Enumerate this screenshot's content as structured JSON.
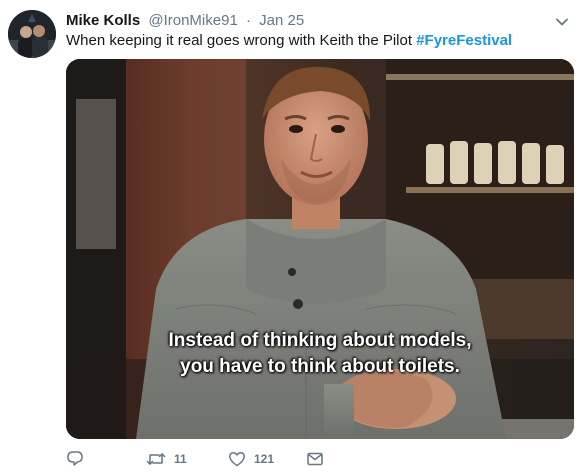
{
  "tweet": {
    "author_name": "Mike Kolls",
    "handle": "@IronMike91",
    "separator": "·",
    "date": "Jan 25",
    "text": "When keeping it real goes wrong with Keith the Pilot",
    "hashtag": "#FyreFestival",
    "media": {
      "caption_line1": "Instead of thinking about models,",
      "caption_line2": "you have to think about toilets."
    },
    "actions": {
      "reply": {
        "icon": "reply-icon"
      },
      "retweet": {
        "icon": "retweet-icon",
        "count": "11"
      },
      "like": {
        "icon": "heart-icon",
        "count": "121"
      },
      "dm": {
        "icon": "envelope-icon"
      }
    }
  },
  "colors": {
    "link": "#1b95e0",
    "secondary_text": "#657786",
    "primary_text": "#14171a"
  }
}
